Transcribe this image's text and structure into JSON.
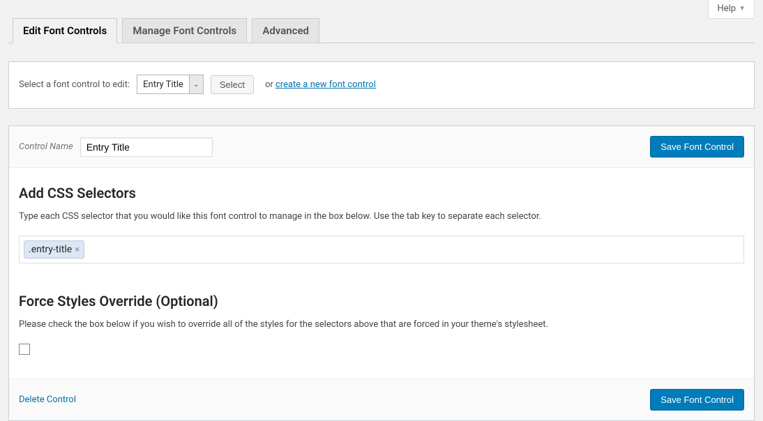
{
  "help": {
    "label": "Help"
  },
  "tabs": {
    "edit": "Edit Font Controls",
    "manage": "Manage Font Controls",
    "advanced": "Advanced"
  },
  "selectRow": {
    "label": "Select a font control to edit:",
    "dropdownValue": "Entry Title",
    "selectBtn": "Select",
    "orText": "or ",
    "createLink": "create a new font control"
  },
  "controlName": {
    "label": "Control Name",
    "value": "Entry Title"
  },
  "saveBtn": "Save Font Control",
  "cssSection": {
    "heading": "Add CSS Selectors",
    "desc": "Type each CSS selector that you would like this font control to manage in the box below. Use the tab key to separate each selector.",
    "tag": ".entry-title"
  },
  "overrideSection": {
    "heading": "Force Styles Override (Optional)",
    "desc": "Please check the box below if you wish to override all of the styles for the selectors above that are forced in your theme's stylesheet."
  },
  "footer": {
    "deleteLink": "Delete Control",
    "saveBtn": "Save Font Control"
  }
}
